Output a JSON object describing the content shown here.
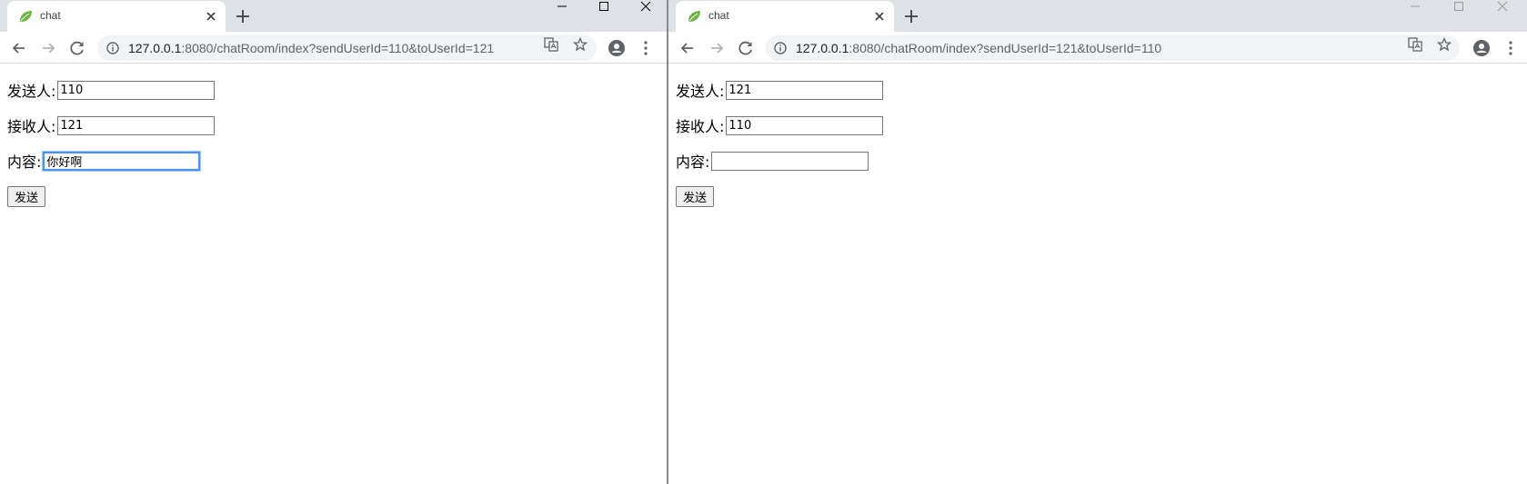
{
  "windows": [
    {
      "tab_title": "chat",
      "url_host": "127.0.0.1",
      "url_rest": ":8080/chatRoom/index?sendUserId=110&toUserId=121",
      "form": {
        "sender_label": "发送人:",
        "sender_value": "110",
        "receiver_label": "接收人:",
        "receiver_value": "121",
        "content_label": "内容:",
        "content_value": "你好啊",
        "send_button": "发送"
      }
    },
    {
      "tab_title": "chat",
      "url_host": "127.0.0.1",
      "url_rest": ":8080/chatRoom/index?sendUserId=121&toUserId=110",
      "form": {
        "sender_label": "发送人:",
        "sender_value": "121",
        "receiver_label": "接收人:",
        "receiver_value": "110",
        "content_label": "内容:",
        "content_value": "",
        "send_button": "发送"
      }
    }
  ],
  "icons": {
    "favicon": "spring-leaf-icon",
    "tab_close": "close-icon",
    "new_tab": "plus-icon",
    "back": "arrow-left-icon",
    "forward": "arrow-right-icon",
    "reload": "reload-icon",
    "site_info": "info-icon",
    "translate": "translate-icon",
    "bookmark": "star-icon",
    "profile": "account-icon",
    "menu": "kebab-menu-icon",
    "minimize": "minimize-icon",
    "maximize": "maximize-icon",
    "close_window": "close-window-icon"
  },
  "colors": {
    "tabstrip": "#dee1e6",
    "omnibox": "#f1f3f4",
    "focus_ring": "#4d90fe",
    "favicon": "#6db33f"
  }
}
